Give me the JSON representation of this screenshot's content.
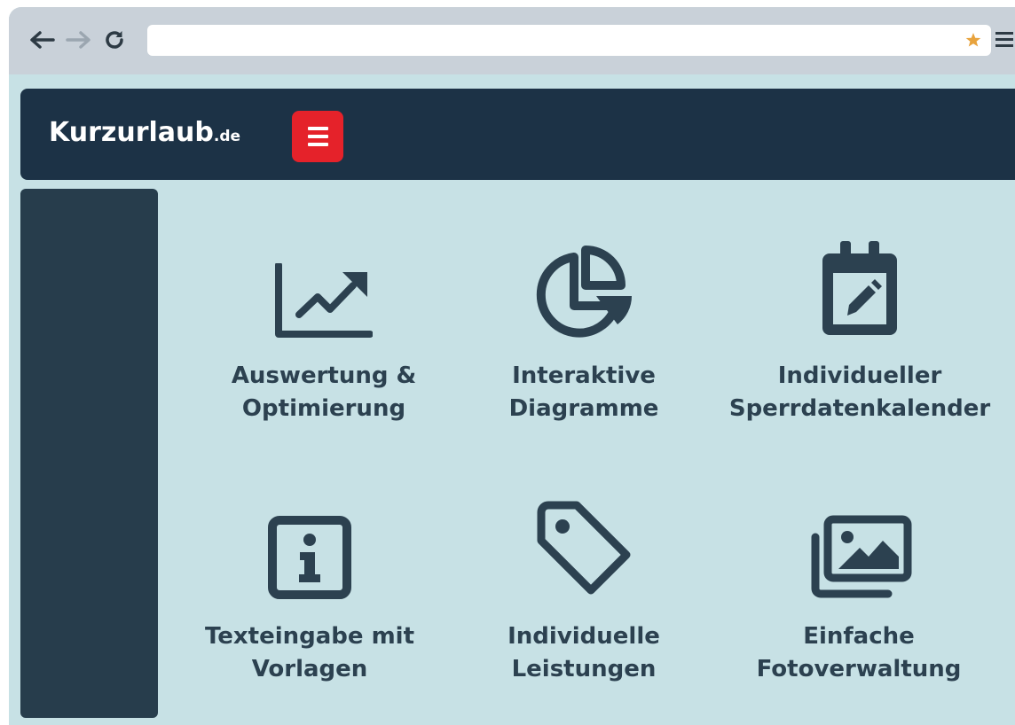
{
  "browser": {
    "url": "",
    "back_icon": "arrow-left-icon",
    "forward_icon": "arrow-right-icon",
    "reload_icon": "reload-icon",
    "bookmark_icon": "star-icon",
    "menu_icon": "hamburger-icon"
  },
  "header": {
    "logo_main": "Kurzurlaub",
    "logo_tld": ".de",
    "menu_button_icon": "hamburger-icon",
    "colors": {
      "header_bg": "#1c3246",
      "menu_button": "#e5222a"
    }
  },
  "features": [
    {
      "icon": "trending-up-chart-icon",
      "line1": "Auswertung &",
      "line2": "Optimierung"
    },
    {
      "icon": "pie-chart-icon",
      "line1": "Interaktive",
      "line2": "Diagramme"
    },
    {
      "icon": "calendar-edit-icon",
      "line1": "Individueller",
      "line2": "Sperrdatenkalender"
    },
    {
      "icon": "info-icon",
      "line1": "Texteingabe mit",
      "line2": "Vorlagen"
    },
    {
      "icon": "tag-icon",
      "line1": "Individuelle",
      "line2": "Leistungen"
    },
    {
      "icon": "photo-gallery-icon",
      "line1": "Einfache",
      "line2": "Fotoverwaltung"
    }
  ]
}
